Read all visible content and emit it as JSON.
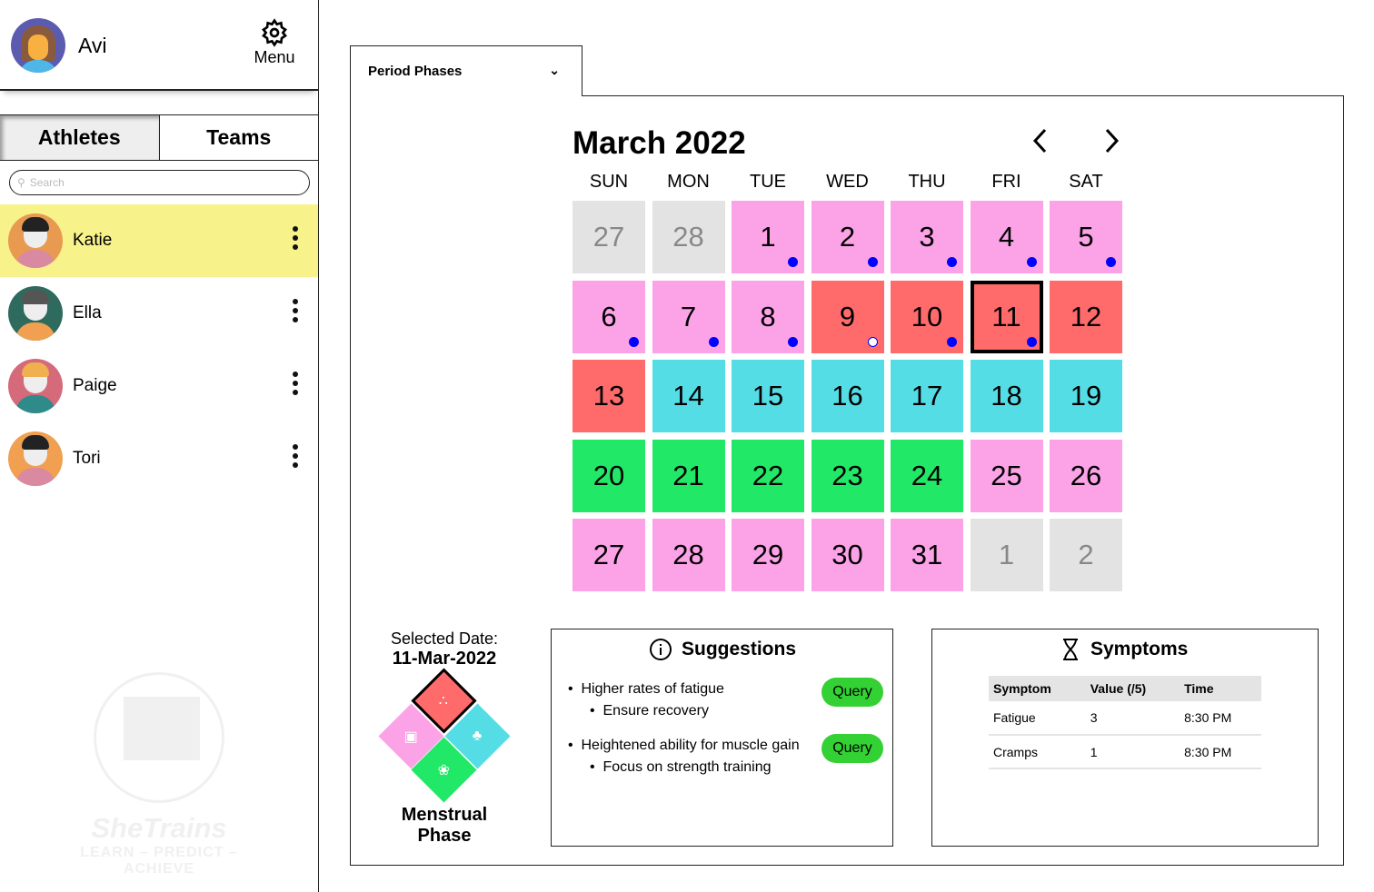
{
  "user": {
    "name": "Avi",
    "menu_label": "Menu"
  },
  "tabs": [
    {
      "label": "Athletes",
      "active": true
    },
    {
      "label": "Teams",
      "active": false
    }
  ],
  "search": {
    "placeholder": "Search",
    "value": ""
  },
  "athletes": [
    {
      "name": "Katie",
      "selected": true
    },
    {
      "name": "Ella",
      "selected": false
    },
    {
      "name": "Paige",
      "selected": false
    },
    {
      "name": "Tori",
      "selected": false
    }
  ],
  "logo": {
    "name": "SheTrains",
    "tagline": "LEARN – PREDICT – ACHIEVE"
  },
  "dropdown": {
    "selected": "Period Phases"
  },
  "calendar": {
    "title": "March 2022",
    "weekdays": [
      "SUN",
      "MON",
      "TUE",
      "WED",
      "THU",
      "FRI",
      "SAT"
    ],
    "phase_colors": {
      "other": "#e3e3e3",
      "follicular": "#fca3e8",
      "menstrual": "#ff6b6b",
      "ovulation": "#55dde6",
      "luteal": "#22e867"
    },
    "dot_color": "#0000ff",
    "days": [
      {
        "label": "27",
        "phase": "other",
        "other": true
      },
      {
        "label": "28",
        "phase": "other",
        "other": true
      },
      {
        "label": "1",
        "phase": "follicular",
        "dot": "filled"
      },
      {
        "label": "2",
        "phase": "follicular",
        "dot": "filled"
      },
      {
        "label": "3",
        "phase": "follicular",
        "dot": "filled"
      },
      {
        "label": "4",
        "phase": "follicular",
        "dot": "filled"
      },
      {
        "label": "5",
        "phase": "follicular",
        "dot": "filled"
      },
      {
        "label": "6",
        "phase": "follicular",
        "dot": "filled"
      },
      {
        "label": "7",
        "phase": "follicular",
        "dot": "filled"
      },
      {
        "label": "8",
        "phase": "follicular",
        "dot": "filled"
      },
      {
        "label": "9",
        "phase": "menstrual",
        "dot": "hollow"
      },
      {
        "label": "10",
        "phase": "menstrual",
        "dot": "filled"
      },
      {
        "label": "11",
        "phase": "menstrual",
        "dot": "filled",
        "selected": true
      },
      {
        "label": "12",
        "phase": "menstrual"
      },
      {
        "label": "13",
        "phase": "menstrual"
      },
      {
        "label": "14",
        "phase": "ovulation"
      },
      {
        "label": "15",
        "phase": "ovulation"
      },
      {
        "label": "16",
        "phase": "ovulation"
      },
      {
        "label": "17",
        "phase": "ovulation"
      },
      {
        "label": "18",
        "phase": "ovulation"
      },
      {
        "label": "19",
        "phase": "ovulation"
      },
      {
        "label": "20",
        "phase": "luteal"
      },
      {
        "label": "21",
        "phase": "luteal"
      },
      {
        "label": "22",
        "phase": "luteal"
      },
      {
        "label": "23",
        "phase": "luteal"
      },
      {
        "label": "24",
        "phase": "luteal"
      },
      {
        "label": "25",
        "phase": "follicular"
      },
      {
        "label": "26",
        "phase": "follicular"
      },
      {
        "label": "27",
        "phase": "follicular"
      },
      {
        "label": "28",
        "phase": "follicular"
      },
      {
        "label": "29",
        "phase": "follicular"
      },
      {
        "label": "30",
        "phase": "follicular"
      },
      {
        "label": "31",
        "phase": "follicular"
      },
      {
        "label": "1",
        "phase": "other",
        "other": true
      },
      {
        "label": "2",
        "phase": "other",
        "other": true
      }
    ]
  },
  "selected": {
    "label": "Selected Date:",
    "date": "11-Mar-2022",
    "phase": "Menstrual Phase"
  },
  "suggestions": {
    "title": "Suggestions",
    "items": [
      {
        "text": "Higher rates of fatigue",
        "sub": "Ensure recovery",
        "button": "Query"
      },
      {
        "text": "Heightened ability for muscle gain",
        "sub": "Focus on strength training",
        "button": "Query"
      }
    ]
  },
  "symptoms": {
    "title": "Symptoms",
    "columns": [
      "Symptom",
      "Value (/5)",
      "Time"
    ],
    "rows": [
      [
        "Fatigue",
        "3",
        "8:30 PM"
      ],
      [
        "Cramps",
        "1",
        "8:30 PM"
      ]
    ]
  }
}
